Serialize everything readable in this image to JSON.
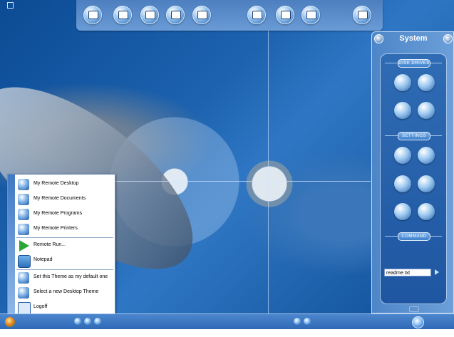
{
  "toolbar": {
    "icons": [
      "network-computer-icon",
      "monitor-icon",
      "documents-icon",
      "window-icon",
      "settings-pencil-icon",
      "globe-arrow-icon",
      "star-icon",
      "globe-icon",
      "trash-icon"
    ]
  },
  "system_panel": {
    "title": "System",
    "sections": {
      "disk_drives": "DISK DRIVES",
      "settings": "SETTINGS",
      "command": "COMMAND"
    },
    "disk_icons": [
      "floppy-drive-icon",
      "hard-drive-icon",
      "cd-drive-icon",
      "dvd-drive-icon"
    ],
    "settings_icons": [
      "display-settings-icon",
      "desktop-settings-icon",
      "text-settings-icon",
      "network-settings-icon",
      "printer-icon",
      "sound-icon"
    ],
    "command_value": "readme.txt"
  },
  "start_menu": {
    "items": [
      {
        "label": "My Remote Desktop",
        "icon": "remote-desktop-icon"
      },
      {
        "label": "My Remote Documents",
        "icon": "remote-documents-icon"
      },
      {
        "label": "My Remote Programs",
        "icon": "remote-programs-icon"
      },
      {
        "label": "My Remote Printers",
        "icon": "remote-printers-icon"
      },
      {
        "label": "Remote Run...",
        "icon": "run-arrow-icon"
      },
      {
        "label": "Notepad",
        "icon": "notepad-icon"
      },
      {
        "label": "Set this Theme as my default one",
        "icon": "theme-default-icon"
      },
      {
        "label": "Select a new Desktop Theme",
        "icon": "theme-select-icon"
      },
      {
        "label": "Logoff",
        "icon": "logoff-icon"
      }
    ]
  },
  "taskbar": {
    "start_icon": "start-orb-icon",
    "quicklaunch": [
      "quicklaunch-icon-1",
      "quicklaunch-icon-2",
      "quicklaunch-icon-3"
    ],
    "tray": [
      "tray-icon-1",
      "tray-icon-2"
    ],
    "right_icon": "globe-icon"
  }
}
